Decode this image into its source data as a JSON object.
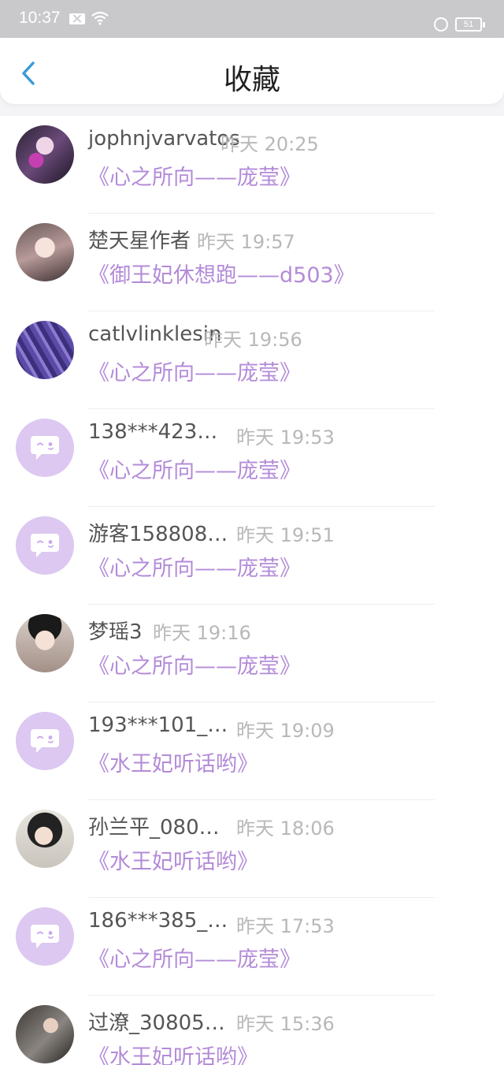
{
  "status": {
    "time": "10:37",
    "battery": "51"
  },
  "header": {
    "title": "收藏"
  },
  "colors": {
    "accent": "#b38bd8",
    "back": "#3a9bd8",
    "avatar_default": "#dcc8f1"
  },
  "items": [
    {
      "name": "jophnjvarvatos",
      "time": "昨天 20:25",
      "book": "《心之所向——庞莹》",
      "avatar": "photo"
    },
    {
      "name": "楚天星作者",
      "time": "昨天 19:57",
      "book": "《御王妃休想跑——d503》",
      "avatar": "photo"
    },
    {
      "name": "catlvlinklesin",
      "time": "昨天 19:56",
      "book": "《心之所向——庞莹》",
      "avatar": "photo"
    },
    {
      "name": "138***423…",
      "time": "昨天 19:53",
      "book": "《心之所向——庞莹》",
      "avatar": "default"
    },
    {
      "name": "游客158808…",
      "time": "昨天 19:51",
      "book": "《心之所向——庞莹》",
      "avatar": "default"
    },
    {
      "name": "梦瑶3",
      "time": "昨天 19:16",
      "book": "《心之所向——庞莹》",
      "avatar": "photo"
    },
    {
      "name": "193***101_…",
      "time": "昨天 19:09",
      "book": "《水王妃听话哟》",
      "avatar": "default"
    },
    {
      "name": "孙兰平_080…",
      "time": "昨天 18:06",
      "book": "《水王妃听话哟》",
      "avatar": "photo"
    },
    {
      "name": "186***385_…",
      "time": "昨天 17:53",
      "book": "《心之所向——庞莹》",
      "avatar": "default"
    },
    {
      "name": "过潦_30805…",
      "time": "昨天 15:36",
      "book": "《水王妃听话哟》",
      "avatar": "photo"
    }
  ]
}
